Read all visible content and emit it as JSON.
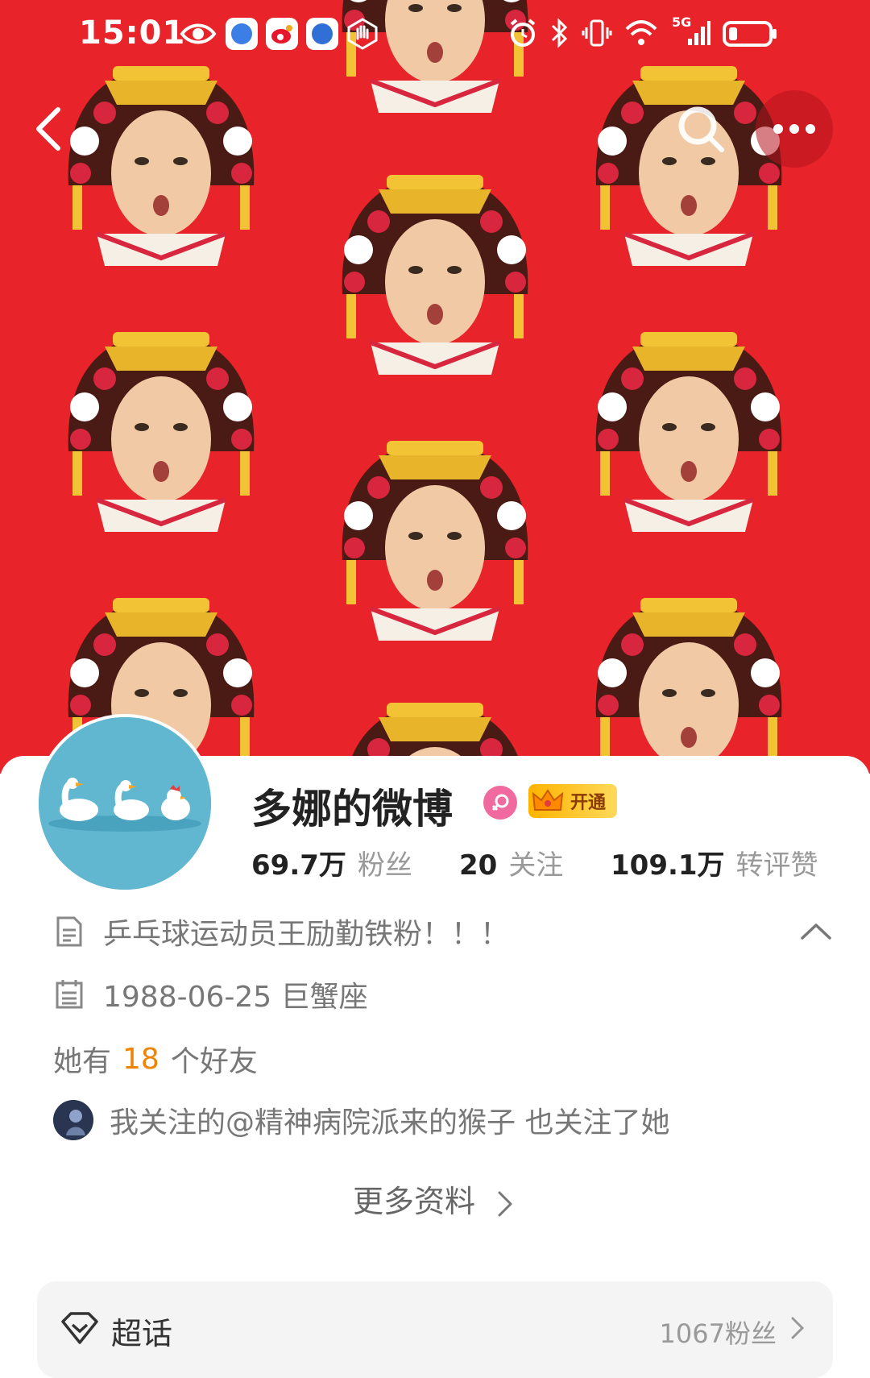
{
  "status_bar": {
    "time": "15:01",
    "network": "5G",
    "icons": [
      "eye-icon",
      "app-icon",
      "weibo-icon",
      "app-icon",
      "hand-icon",
      "alarm-icon",
      "bluetooth-icon",
      "vibrate-icon",
      "wifi-icon",
      "signal-icon",
      "battery-icon"
    ]
  },
  "nav": {
    "back_icon": "chevron-left-icon",
    "search_icon": "search-icon",
    "more_icon": "more-dots-icon"
  },
  "profile": {
    "name": "多娜的微博",
    "vip_label": "开通",
    "stats": [
      {
        "value": "69.7万",
        "label": "粉丝"
      },
      {
        "value": "20",
        "label": "关注"
      },
      {
        "value": "109.1万",
        "label": "转评赞"
      }
    ],
    "bio": "乒乓球运动员王励勤铁粉！！！",
    "birthday": "1988-06-25 巨蟹座",
    "friends_prefix": "她有",
    "friends_count": "18",
    "friends_suffix": "个好友",
    "mutual": "我关注的@精神病院派来的猴子 也关注了她",
    "more_info": "更多资料"
  },
  "super_topic": {
    "label": "超话",
    "fans": "1067粉丝"
  },
  "colors": {
    "cover_red": "#e8232a",
    "accent_orange": "#f08300",
    "avatar_bg": "#62b7d0",
    "gender_pink": "#f06aa0",
    "vip_gold": "#ffb300"
  }
}
